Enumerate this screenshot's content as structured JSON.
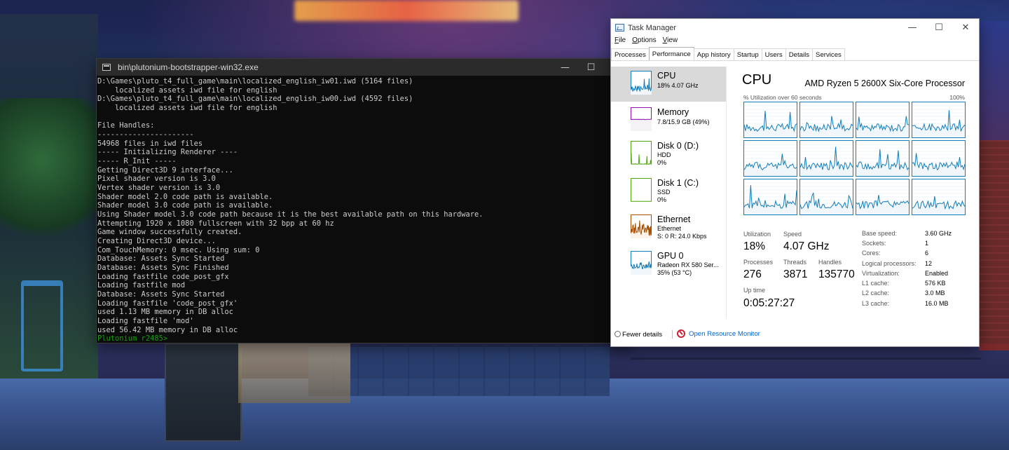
{
  "console": {
    "title": "bin\\plutonium-bootstrapper-win32.exe",
    "lines": [
      "D:\\Games\\pluto_t4_full_game\\main\\localized_english_iw01.iwd (5164 files)",
      "    localized assets iwd file for english",
      "D:\\Games\\pluto_t4_full_game\\main\\localized_english_iw00.iwd (4592 files)",
      "    localized assets iwd file for english",
      "",
      "File Handles:",
      "----------------------",
      "54968 files in iwd files",
      "----- Initializing Renderer ----",
      "----- R_Init -----",
      "Getting Direct3D 9 interface...",
      "Pixel shader version is 3.0",
      "Vertex shader version is 3.0",
      "Shader model 2.0 code path is available.",
      "Shader model 3.0 code path is available.",
      "Using Shader model 3.0 code path because it is the best available path on this hardware.",
      "Attempting 1920 x 1080 fullscreen with 32 bpp at 60 hz",
      "Game window successfully created.",
      "Creating Direct3D device...",
      "Com_TouchMemory: 0 msec. Using sum: 0",
      "Database: Assets Sync Started",
      "Database: Assets Sync Finished",
      "Loading fastfile code_post_gfx",
      "Loading fastfile mod",
      "Database: Assets Sync Started",
      "Loading fastfile 'code_post_gfx'",
      "used 1.13 MB memory in DB alloc",
      "Loading fastfile 'mod'",
      "used 56.42 MB memory in DB alloc"
    ],
    "prompt": "Plutonium r2485>"
  },
  "taskmanager": {
    "title": "Task Manager",
    "menu": [
      "File",
      "Options",
      "View"
    ],
    "tabs": [
      "Processes",
      "Performance",
      "App history",
      "Startup",
      "Users",
      "Details",
      "Services"
    ],
    "active_tab": "Performance",
    "sidebar": [
      {
        "name": "CPU",
        "sub1": "18% 4.07 GHz",
        "sub2": "",
        "color": "#117dbb"
      },
      {
        "name": "Memory",
        "sub1": "7.8/15.9 GB (49%)",
        "sub2": "",
        "color": "#8b12ae"
      },
      {
        "name": "Disk 0 (D:)",
        "sub1": "HDD",
        "sub2": "0%",
        "color": "#4da60c"
      },
      {
        "name": "Disk 1 (C:)",
        "sub1": "SSD",
        "sub2": "0%",
        "color": "#4da60c"
      },
      {
        "name": "Ethernet",
        "sub1": "Ethernet",
        "sub2": "S: 0 R: 24.0 Kbps",
        "color": "#a74f01"
      },
      {
        "name": "GPU 0",
        "sub1": "Radeon RX 580 Ser...",
        "sub2": "35% (53 °C)",
        "color": "#117dbb"
      }
    ],
    "cpu": {
      "header": "CPU",
      "model": "AMD Ryzen 5 2600X Six-Core Processor",
      "graph_label": "% Utilization over 60 seconds",
      "graph_max": "100%",
      "utilization_label": "Utilization",
      "utilization": "18%",
      "speed_label": "Speed",
      "speed": "4.07 GHz",
      "processes_label": "Processes",
      "processes": "276",
      "threads_label": "Threads",
      "threads": "3871",
      "handles_label": "Handles",
      "handles": "135770",
      "uptime_label": "Up time",
      "uptime": "0:05:27:27",
      "details": [
        {
          "label": "Base speed:",
          "value": "3.60 GHz"
        },
        {
          "label": "Sockets:",
          "value": "1"
        },
        {
          "label": "Cores:",
          "value": "6"
        },
        {
          "label": "Logical processors:",
          "value": "12"
        },
        {
          "label": "Virtualization:",
          "value": "Enabled"
        },
        {
          "label": "L1 cache:",
          "value": "576 KB"
        },
        {
          "label": "L2 cache:",
          "value": "3.0 MB"
        },
        {
          "label": "L3 cache:",
          "value": "16.0 MB"
        }
      ],
      "graph_color": "#117dbb",
      "graph_fill": "#f1f6fa"
    },
    "footer": {
      "fewer_details": "Fewer details",
      "open_resource_monitor": "Open Resource Monitor"
    }
  }
}
